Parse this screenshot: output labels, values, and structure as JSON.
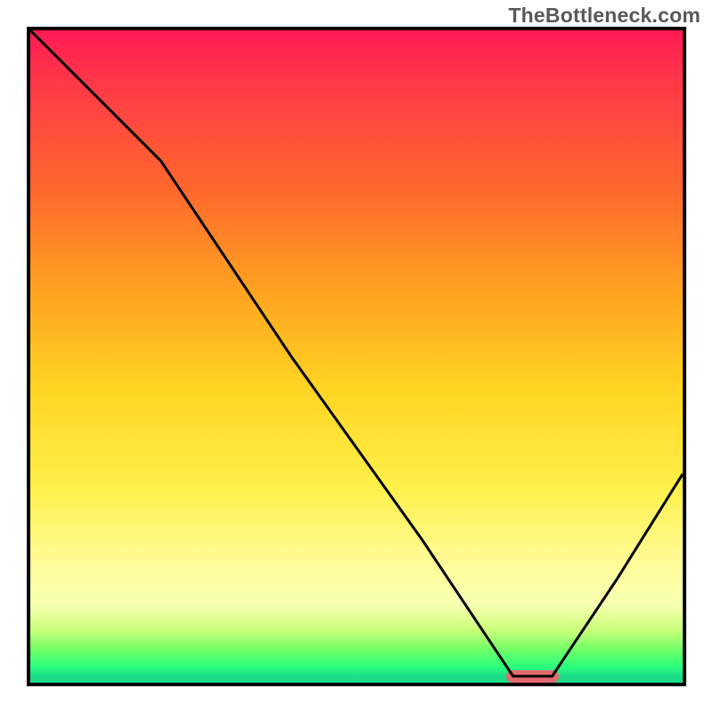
{
  "watermark": "TheBottleneck.com",
  "colors": {
    "frame_border": "#000000",
    "curve": "#000000",
    "marker": "#e26a6e",
    "gradient_top": "#ff1a53",
    "gradient_bottom": "#1cdc8a"
  },
  "chart_data": {
    "type": "line",
    "title": "",
    "xlabel": "",
    "ylabel": "",
    "xlim": [
      0,
      100
    ],
    "ylim": [
      0,
      100
    ],
    "x": [
      0,
      10,
      20,
      30,
      40,
      50,
      60,
      70,
      74,
      80,
      90,
      100
    ],
    "values": [
      100,
      90,
      80,
      65,
      50,
      36,
      22,
      7,
      1,
      1,
      16,
      32
    ],
    "annotations": [
      {
        "shape": "pill",
        "x_start": 73,
        "x_end": 81,
        "y": 1,
        "color": "#e26a6e"
      }
    ],
    "notes": "Background is a vertical severity gradient from red (high) to green (low). The black curve shows bottleneck severity vs. an implicit horizontal axis; minimum (optimal) region is marked by the pink pill near x≈73–81."
  }
}
